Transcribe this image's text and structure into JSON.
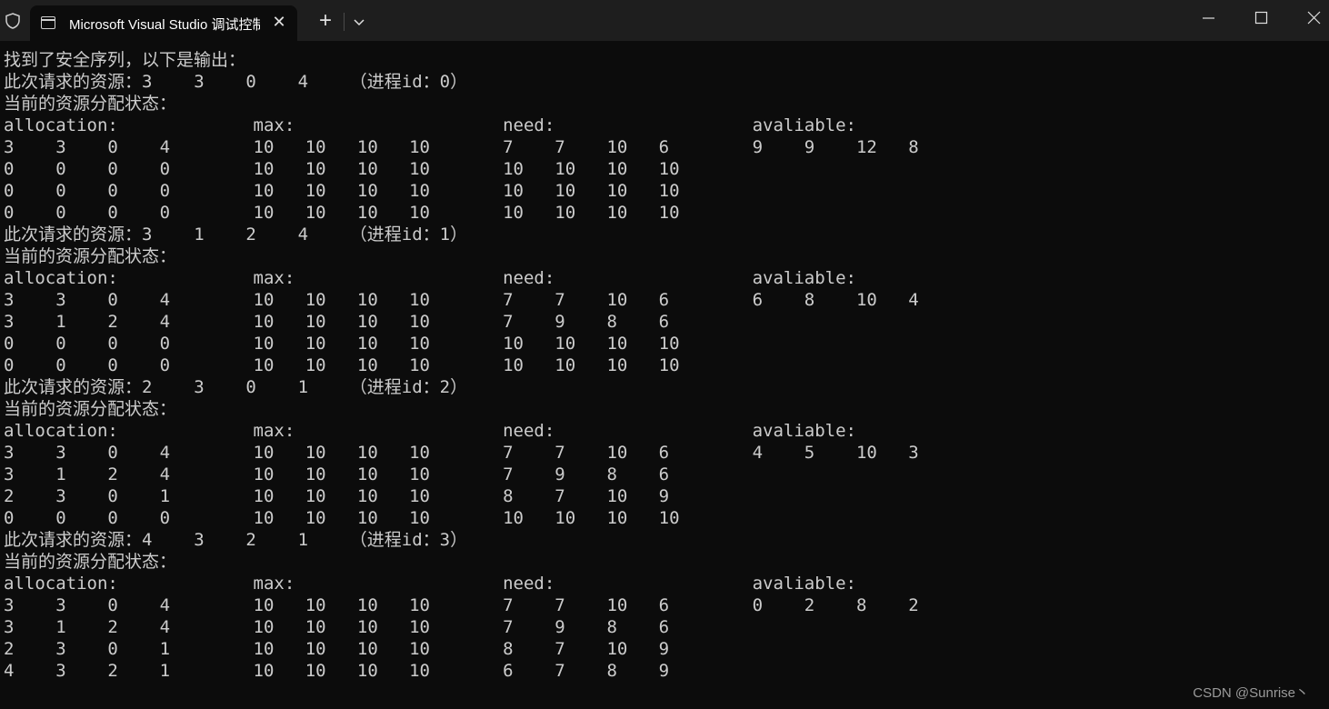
{
  "window": {
    "tab_title": "Microsoft Visual Studio 调试控制台",
    "tab_icon": "console-icon",
    "new_tab_label": "+",
    "tab_close_label": "✕"
  },
  "console": {
    "lines": [
      "找到了安全序列，以下是输出：",
      "此次请求的资源：3    3    0    4    （进程id：0）",
      "当前的资源分配状态：",
      "allocation:             max:                    need:                   avaliable:",
      "3    3    0    4        10   10   10   10       7    7    10   6        9    9    12   8",
      "0    0    0    0        10   10   10   10       10   10   10   10",
      "0    0    0    0        10   10   10   10       10   10   10   10",
      "0    0    0    0        10   10   10   10       10   10   10   10",
      "此次请求的资源：3    1    2    4    （进程id：1）",
      "当前的资源分配状态：",
      "allocation:             max:                    need:                   avaliable:",
      "3    3    0    4        10   10   10   10       7    7    10   6        6    8    10   4",
      "3    1    2    4        10   10   10   10       7    9    8    6",
      "0    0    0    0        10   10   10   10       10   10   10   10",
      "0    0    0    0        10   10   10   10       10   10   10   10",
      "此次请求的资源：2    3    0    1    （进程id：2）",
      "当前的资源分配状态：",
      "allocation:             max:                    need:                   avaliable:",
      "3    3    0    4        10   10   10   10       7    7    10   6        4    5    10   3",
      "3    1    2    4        10   10   10   10       7    9    8    6",
      "2    3    0    1        10   10   10   10       8    7    10   9",
      "0    0    0    0        10   10   10   10       10   10   10   10",
      "此次请求的资源：4    3    2    1    （进程id：3）",
      "当前的资源分配状态：",
      "allocation:             max:                    need:                   avaliable:",
      "3    3    0    4        10   10   10   10       7    7    10   6        0    2    8    2",
      "3    1    2    4        10   10   10   10       7    9    8    6",
      "2    3    0    1        10   10   10   10       8    7    10   9",
      "4    3    2    1        10   10   10   10       6    7    8    9"
    ]
  },
  "watermark": "CSDN @Sunrise丶",
  "colors": {
    "background": "#0c0c0c",
    "text": "#cccccc",
    "titlebar": "#1e1e1e"
  }
}
